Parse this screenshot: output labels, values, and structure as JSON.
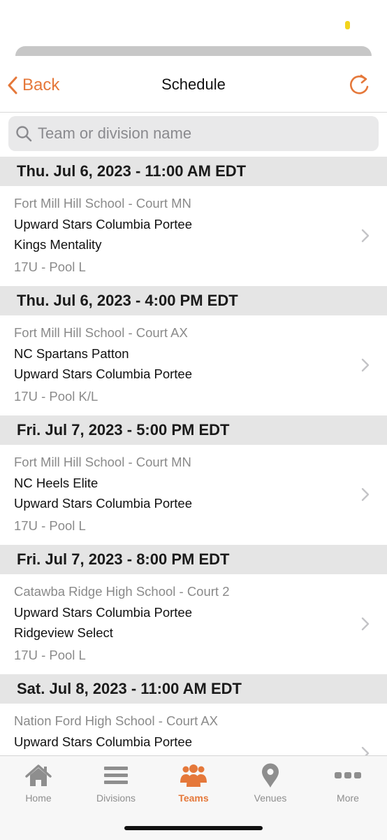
{
  "nav": {
    "back_label": "Back",
    "title": "Schedule"
  },
  "search": {
    "placeholder": "Team or division name",
    "value": ""
  },
  "schedule": [
    {
      "header": "Thu. Jul 6, 2023 - 11:00 AM EDT",
      "venue": "Fort Mill Hill School - Court MN",
      "team1": "Upward Stars Columbia Portee",
      "team2": "Kings Mentality",
      "division": "17U - Pool L"
    },
    {
      "header": "Thu. Jul 6, 2023 - 4:00 PM EDT",
      "venue": "Fort Mill Hill School - Court AX",
      "team1": "NC Spartans Patton",
      "team2": "Upward Stars Columbia Portee",
      "division": "17U - Pool K/L"
    },
    {
      "header": "Fri. Jul 7, 2023 - 5:00 PM EDT",
      "venue": "Fort Mill Hill School - Court MN",
      "team1": "NC Heels Elite",
      "team2": "Upward Stars Columbia Portee",
      "division": "17U - Pool L"
    },
    {
      "header": "Fri. Jul 7, 2023 - 8:00 PM EDT",
      "venue": "Catawba Ridge High School - Court 2",
      "team1": "Upward Stars Columbia Portee",
      "team2": "Ridgeview Select",
      "division": "17U - Pool L"
    },
    {
      "header": "Sat. Jul 8, 2023 - 11:00 AM EDT",
      "venue": "Nation Ford High School - Court AX",
      "team1": "Upward Stars Columbia Portee",
      "team2": "",
      "division": ""
    }
  ],
  "tabs": [
    {
      "label": "Home",
      "icon": "house-icon",
      "active": false
    },
    {
      "label": "Divisions",
      "icon": "list-icon",
      "active": false
    },
    {
      "label": "Teams",
      "icon": "people-icon",
      "active": true
    },
    {
      "label": "Venues",
      "icon": "map-pin-icon",
      "active": false
    },
    {
      "label": "More",
      "icon": "ellipsis-icon",
      "active": false
    }
  ],
  "colors": {
    "accent": "#e5783a",
    "section_header_bg": "#e5e5e5",
    "inactive_tab": "#8e8e8e",
    "secondary_text": "#8a8a8a"
  }
}
